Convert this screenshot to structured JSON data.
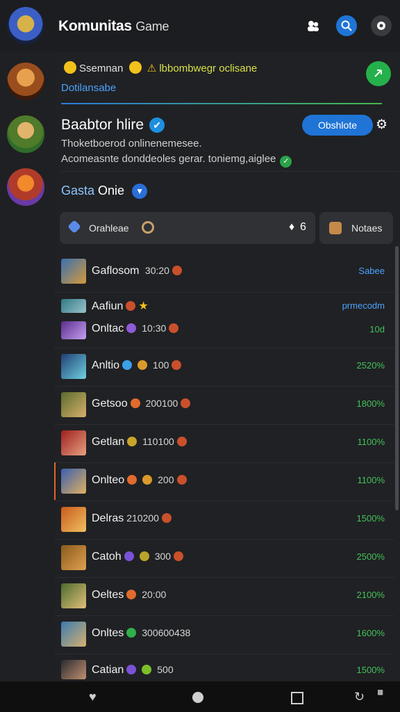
{
  "header": {
    "title": "Komunitas",
    "title_suffix": "Game",
    "icons": [
      "people-icon",
      "search-icon",
      "settings-icon"
    ],
    "colors": {
      "search": "#1f74d6",
      "background": "#1c1d20"
    }
  },
  "notification": {
    "prefix": "Ssemnan",
    "highlight": "lbbombwegr oclisane",
    "subtitle": "Dotilansabe"
  },
  "post": {
    "title": "Baabtor hlire",
    "button_label": "Obshlote",
    "line1": "Thoketboerod onlinenemesee.",
    "line2": "Acomeasnte donddeoles gerar. toniemg,aiglee"
  },
  "group": {
    "title_a": "Gasta",
    "title_b": "Onie"
  },
  "tabs": {
    "left_label": "Orahleae",
    "left_count": "6",
    "right_label": "Notaes"
  },
  "rows": [
    {
      "name": "Gaflosom",
      "time": "30:20",
      "value": "Sabee",
      "value_color": "#4aa3ff"
    },
    {
      "name": "Aafiun",
      "time": "",
      "value": "prmecodm",
      "value_color": "#4aa3ff"
    },
    {
      "name": "Onltac",
      "time": "10:30",
      "value": "10d",
      "value_color": "#43c15a"
    },
    {
      "name": "Anltio",
      "time": "100",
      "value": "2520%",
      "value_color": "#43c15a"
    },
    {
      "name": "Getsoo",
      "time": "200100",
      "value": "1800%",
      "value_color": "#43c15a"
    },
    {
      "name": "Getlan",
      "time": "110100",
      "value": "1100%",
      "value_color": "#43c15a"
    },
    {
      "name": "Onlteo",
      "time": "200",
      "value": "1100%",
      "value_color": "#43c15a"
    },
    {
      "name": "Delras",
      "time": "210200",
      "value": "1500%",
      "value_color": "#43c15a"
    },
    {
      "name": "Catoh",
      "time": "300",
      "value": "2500%",
      "value_color": "#43c15a"
    },
    {
      "name": "Oeltes",
      "time": "20:00",
      "value": "2100%",
      "value_color": "#43c15a"
    },
    {
      "name": "Onltes",
      "time": "300600438",
      "value": "1600%",
      "value_color": "#43c15a"
    },
    {
      "name": "Catian",
      "time": "500",
      "value": "1500%",
      "value_color": "#43c15a"
    }
  ]
}
